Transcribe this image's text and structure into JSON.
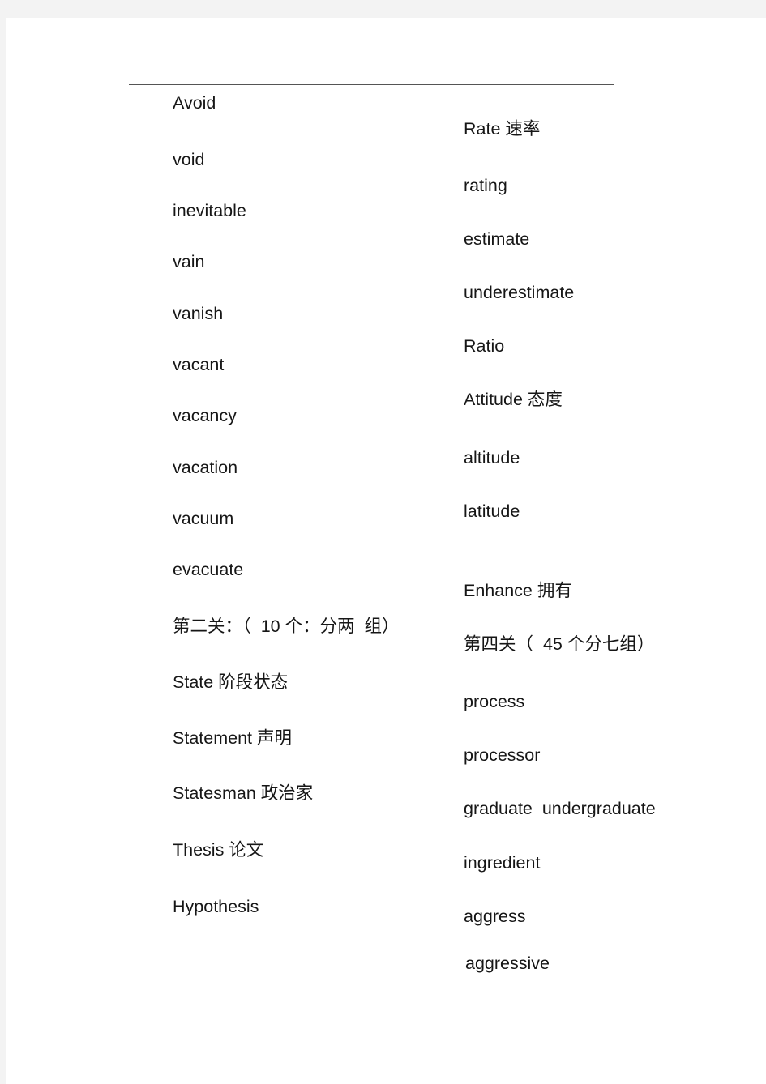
{
  "left_column": [
    {
      "text": "Avoid"
    },
    {
      "text": "void"
    },
    {
      "text": "inevitable"
    },
    {
      "text": "vain"
    },
    {
      "text": "vanish"
    },
    {
      "text": "vacant"
    },
    {
      "text": "vacancy"
    },
    {
      "text": "vacation"
    },
    {
      "text": "vacuum"
    },
    {
      "text": "evacuate"
    },
    {
      "text": "第二关：（  10 个：分两  组）"
    },
    {
      "text": "State 阶段状态"
    },
    {
      "text": "Statement 声明"
    },
    {
      "text": "Statesman 政治家"
    },
    {
      "text": "Thesis 论文"
    },
    {
      "text": "Hypothesis"
    }
  ],
  "right_column": [
    {
      "text": "Rate 速率"
    },
    {
      "text": "rating"
    },
    {
      "text": "estimate"
    },
    {
      "text": "underestimate"
    },
    {
      "text": "Ratio"
    },
    {
      "text": "Attitude 态度"
    },
    {
      "text": "altitude"
    },
    {
      "text": "latitude"
    },
    {
      "text": "Enhance 拥有"
    },
    {
      "text": "第四关（  45 个分七组）"
    },
    {
      "text": "process"
    },
    {
      "text": "processor"
    },
    {
      "text": "graduate  undergraduate"
    },
    {
      "text": "ingredient"
    },
    {
      "text": "aggress"
    },
    {
      "text": "aggressive"
    }
  ]
}
